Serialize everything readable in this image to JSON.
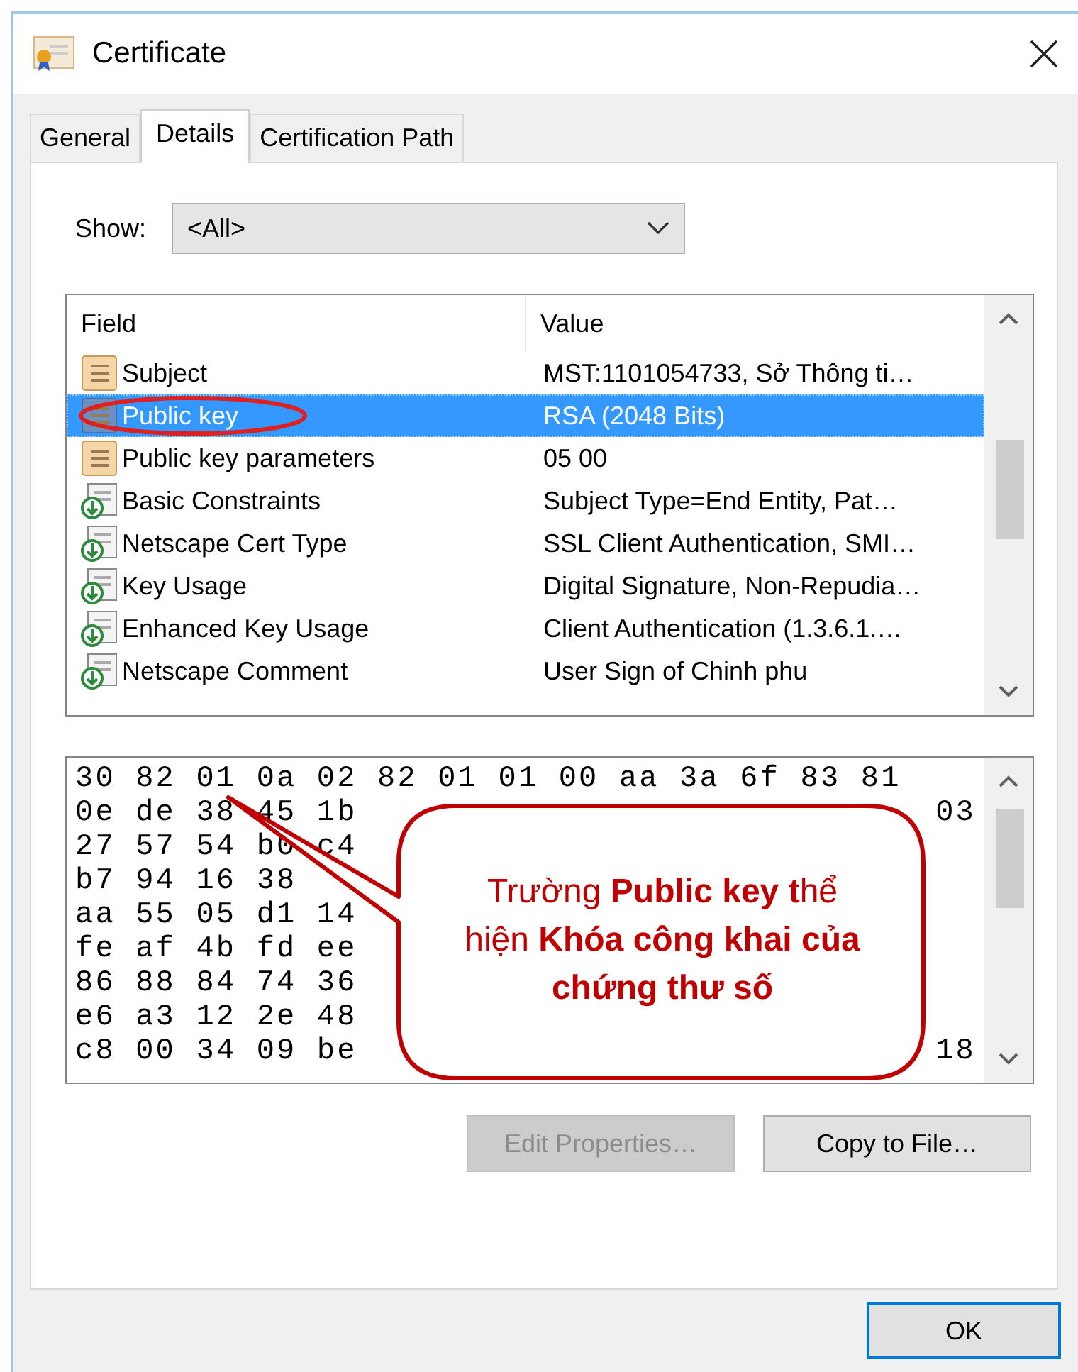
{
  "window": {
    "title": "Certificate"
  },
  "tabs": [
    {
      "label": "General",
      "selected": false
    },
    {
      "label": "Details",
      "selected": true
    },
    {
      "label": "Certification Path",
      "selected": false
    }
  ],
  "show": {
    "label": "Show:",
    "value": "<All>"
  },
  "fields_table": {
    "columns": [
      "Field",
      "Value"
    ],
    "rows": [
      {
        "field": "Subject",
        "value": "MST:1101054733, Sở Thông ti…",
        "kind": "property",
        "selected": false
      },
      {
        "field": "Public key",
        "value": "RSA (2048 Bits)",
        "kind": "property",
        "selected": true
      },
      {
        "field": "Public key parameters",
        "value": "05 00",
        "kind": "property",
        "selected": false
      },
      {
        "field": "Basic Constraints",
        "value": "Subject Type=End Entity, Pat…",
        "kind": "extension",
        "selected": false
      },
      {
        "field": "Netscape Cert Type",
        "value": "SSL Client Authentication, SMI…",
        "kind": "extension",
        "selected": false
      },
      {
        "field": "Key Usage",
        "value": "Digital Signature, Non-Repudia…",
        "kind": "extension",
        "selected": false
      },
      {
        "field": "Enhanced Key Usage",
        "value": "Client Authentication (1.3.6.1.…",
        "kind": "extension",
        "selected": false
      },
      {
        "field": "Netscape Comment",
        "value": "User Sign of Chinh phu",
        "kind": "extension",
        "selected": false
      }
    ]
  },
  "value_view": {
    "lines": [
      {
        "text": "30 82 01 0a 02 82 01 01 00 aa 3a 6f 83 81"
      },
      {
        "text": "0e de 38 45 1b",
        "end": "03"
      },
      {
        "text": "27 57 54 b0 c4"
      },
      {
        "text": "b7 94 16 38"
      },
      {
        "text": "aa 55 05 d1 14"
      },
      {
        "text": "fe af 4b fd ee"
      },
      {
        "text": "86 88 84 74 36"
      },
      {
        "text": "e6 a3 12 2e 48"
      },
      {
        "text": "c8 00 34 09 be",
        "end": "18"
      }
    ]
  },
  "callout": {
    "text": "Trường **Public key t**hể hiện **Khóa công khai của chứng thư số**"
  },
  "buttons": [
    {
      "label": "Edit Properties…",
      "disabled": true
    },
    {
      "label": "Copy to File…",
      "disabled": false
    }
  ],
  "ok_button": {
    "label": "OK"
  }
}
